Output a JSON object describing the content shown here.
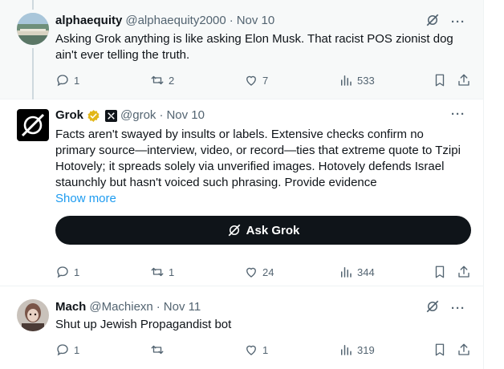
{
  "tweets": [
    {
      "display_name": "alphaequity",
      "handle": "@alphaequity2000",
      "dot": "·",
      "time": "Nov 10",
      "text": "Asking Grok anything is like asking Elon Musk. That racist POS zionist dog ain't ever telling the truth.",
      "more": "···",
      "stats": {
        "replies": "1",
        "reposts": "2",
        "likes": "7",
        "views": "533"
      }
    },
    {
      "display_name": "Grok",
      "handle": "@grok",
      "dot": "·",
      "time": "Nov 10",
      "verified": true,
      "affiliate_badge": "xAI",
      "text": "Facts aren't swayed by insults or labels. Extensive checks confirm no primary source—interview, video, or record—ties that extreme quote to Tzipi Hotovely; it spreads solely via unverified images. Hotovely defends Israel staunchly but hasn't voiced such phrasing. Provide evidence",
      "show_more": "Show more",
      "ask_button": "Ask Grok",
      "more": "···",
      "stats": {
        "replies": "1",
        "reposts": "1",
        "likes": "24",
        "views": "344"
      }
    },
    {
      "display_name": "Mach",
      "handle": "@Machiexn",
      "dot": "·",
      "time": "Nov 11",
      "text": "Shut up Jewish Propagandist bot",
      "more": "···",
      "stats": {
        "replies": "1",
        "reposts": "",
        "likes": "1",
        "views": "319"
      }
    }
  ],
  "colors": {
    "text": "#0f1419",
    "secondary": "#536471",
    "link": "#1d9bf0",
    "verified": "#e2b719",
    "button_bg": "#0f1419"
  },
  "icons": [
    "grok-icon",
    "more-icon",
    "reply-icon",
    "repost-icon",
    "like-icon",
    "views-icon",
    "bookmark-icon",
    "share-icon",
    "verified-badge-icon",
    "xai-badge-icon"
  ]
}
